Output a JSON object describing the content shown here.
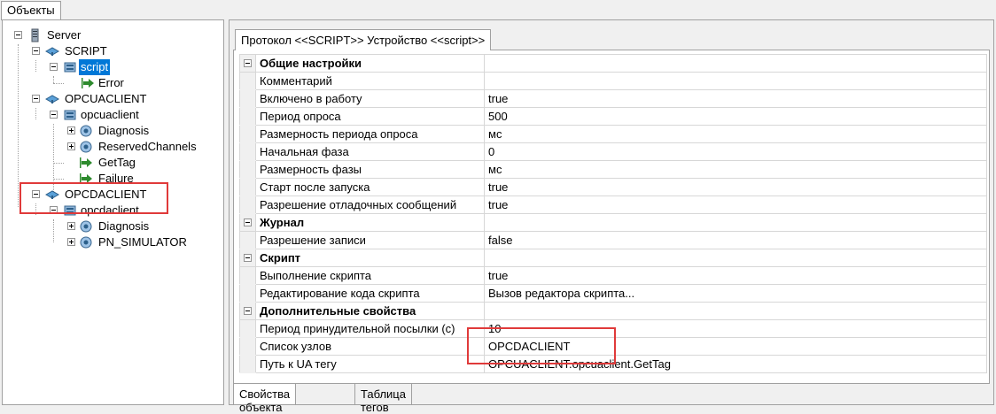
{
  "top_tab": "Объекты",
  "tree": [
    {
      "label": "Server"
    },
    {
      "label": "SCRIPT"
    },
    {
      "label": "script",
      "selected": true
    },
    {
      "label": "Error"
    },
    {
      "label": "OPCUACLIENT"
    },
    {
      "label": "opcuaclient"
    },
    {
      "label": "Diagnosis"
    },
    {
      "label": "ReservedChannels"
    },
    {
      "label": "GetTag"
    },
    {
      "label": "Failure"
    },
    {
      "label": "OPCDACLIENT"
    },
    {
      "label": "opcdaclient"
    },
    {
      "label": "Diagnosis"
    },
    {
      "label": "PN_SIMULATOR"
    }
  ],
  "inner_tab": "Протокол <<SCRIPT>> Устройство <<script>>",
  "properties": [
    {
      "name": "Общие настройки",
      "value": "",
      "category": true
    },
    {
      "name": "Комментарий",
      "value": ""
    },
    {
      "name": "Включено в работу",
      "value": "true"
    },
    {
      "name": "Период опроса",
      "value": "500"
    },
    {
      "name": "Размерность периода опроса",
      "value": "мс"
    },
    {
      "name": "Начальная фаза",
      "value": "0"
    },
    {
      "name": "Размерность фазы",
      "value": "мс"
    },
    {
      "name": "Старт после запуска",
      "value": "true"
    },
    {
      "name": "Разрешение отладочных сообщений",
      "value": "true"
    },
    {
      "name": "Журнал",
      "value": "",
      "category": true
    },
    {
      "name": "Разрешение записи",
      "value": "false"
    },
    {
      "name": "Скрипт",
      "value": "",
      "category": true
    },
    {
      "name": "Выполнение скрипта",
      "value": "true"
    },
    {
      "name": "Редактирование кода скрипта",
      "value": "Вызов редактора скрипта..."
    },
    {
      "name": "Дополнительные свойства",
      "value": "",
      "category": true
    },
    {
      "name": "Период принудительной посылки (с)",
      "value": "10"
    },
    {
      "name": "Список узлов",
      "value": "OPCDACLIENT"
    },
    {
      "name": "Путь к UA тегу",
      "value": "OPCUACLIENT.opcuaclient.GetTag"
    }
  ],
  "bottom_tabs": [
    "Свойства объекта",
    "Таблица тегов"
  ],
  "colors": {
    "selection": "#0078d7",
    "highlight": "#e03a3a",
    "arrow": "#2e8b2e"
  }
}
